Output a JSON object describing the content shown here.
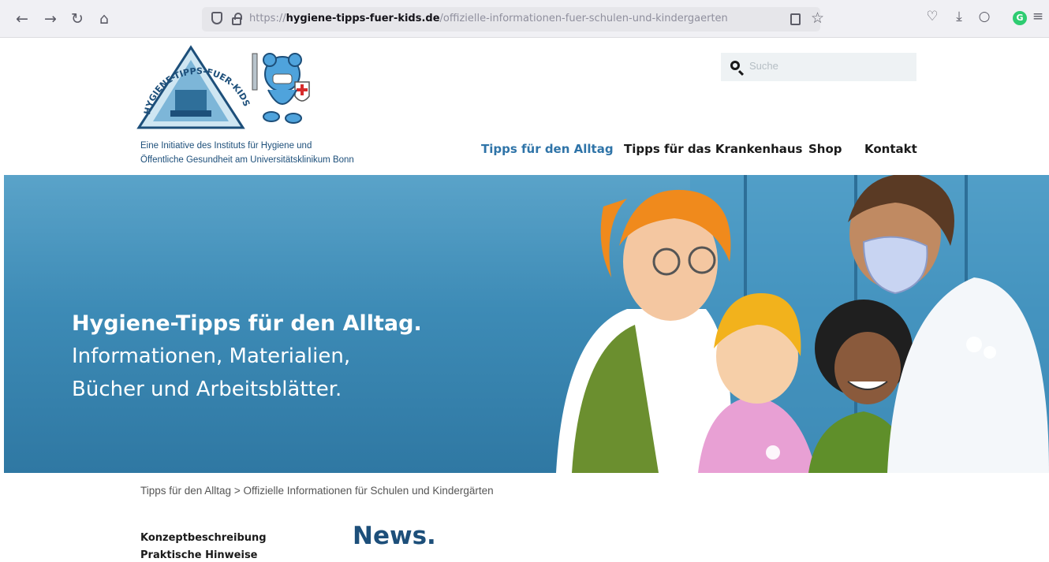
{
  "browser": {
    "url_scheme": "https://",
    "url_host": "hygiene-tipps-fuer-kids.de",
    "url_path": "/offizielle-informationen-fuer-schulen-und-kindergaerten",
    "back_icon": "←",
    "forward_icon": "→",
    "reload_icon": "↻",
    "home_icon": "⌂",
    "bookmark_icon": "☆",
    "pocket_icon": "♡",
    "download_icon": "⤓",
    "extension_icon": "○",
    "profile_letter": "G",
    "menu_icon": "≡"
  },
  "header": {
    "logo_text": "HYGIENE-TIPPS-FUER-KIDS.DE",
    "tagline_line1": "Eine Initiative des Instituts für Hygiene und",
    "tagline_line2": "Öffentliche Gesundheit am Universitätsklinikum Bonn",
    "search_placeholder": "Suche"
  },
  "nav": {
    "items": [
      {
        "label": "Tipps für den Alltag",
        "active": true
      },
      {
        "label": "Tipps für das Krankenhaus",
        "active": false
      },
      {
        "label": "Shop",
        "active": false
      },
      {
        "label": "Kontakt",
        "active": false
      }
    ]
  },
  "hero": {
    "title": "Hygiene-Tipps für den Alltag.",
    "subtitle_line1": "Informationen, Materialien,",
    "subtitle_line2": "Bücher und Arbeitsblätter."
  },
  "breadcrumb": "Tipps für den Alltag > Offizielle Informationen für Schulen und Kindergärten",
  "sidebar": {
    "items": [
      {
        "label": "Konzeptbeschreibung"
      },
      {
        "label": "Praktische Hinweise"
      }
    ]
  },
  "main": {
    "heading": "News."
  },
  "colors": {
    "brand_blue": "#1d4f7a",
    "nav_active": "#2f74a8",
    "hero_blue": "#3d8bb6"
  }
}
